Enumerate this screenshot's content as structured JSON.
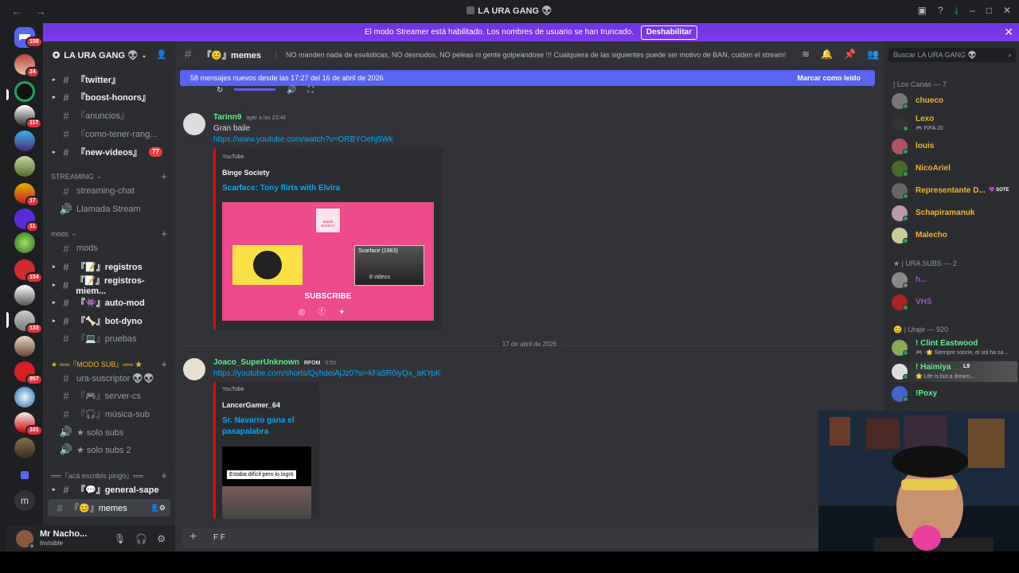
{
  "window": {
    "title": "LA URA GANG 👽"
  },
  "banner": {
    "text": "El modo Streamer está habilitado. Los nombres de usuario se han truncado.",
    "button": "Deshabilitar",
    "close": "✕"
  },
  "guilds": [
    {
      "badge": "158"
    },
    {
      "badge": "24"
    },
    {
      "badge": ""
    },
    {
      "badge": "117"
    },
    {
      "badge": ""
    },
    {
      "badge": ""
    },
    {
      "badge": "17"
    },
    {
      "badge": "11"
    },
    {
      "badge": ""
    },
    {
      "badge": "154"
    },
    {
      "badge": ""
    },
    {
      "badge": "133"
    },
    {
      "badge": ""
    },
    {
      "badge": "957"
    },
    {
      "badge": ""
    },
    {
      "badge": "101"
    },
    {
      "badge": ""
    }
  ],
  "guild_letter": "m",
  "server": {
    "name": "LA URA GANG 👽",
    "channels": [
      {
        "name": "『twitter』"
      },
      {
        "name": "『boost-honors』"
      },
      {
        "name": "『anuncios』"
      },
      {
        "name": "『como-tener-rang..."
      },
      {
        "name": "『new-videos』",
        "mentions": "77"
      }
    ],
    "streaming_category": "STREAMING",
    "streaming_channels": [
      {
        "name": "streaming-chat"
      },
      {
        "name": "Llamada Stream"
      }
    ],
    "mods_category": "mods",
    "mods_channels": [
      {
        "name": "mods"
      },
      {
        "name": "『📝』registros"
      },
      {
        "name": "『📝』registros-miem..."
      },
      {
        "name": "『👾』auto-mod"
      },
      {
        "name": "『🦴』bot-dyno"
      },
      {
        "name": "『💻』pruebas"
      }
    ],
    "sub_category": "★ ══『MODO SUB』══ ★",
    "sub_channels": [
      {
        "name": "ura-suscriptor 👽👽"
      },
      {
        "name": "『🎮』server-cs"
      },
      {
        "name": "『🎧』música-sub"
      },
      {
        "name": "★ solo subs"
      },
      {
        "name": "★ solo subs 2"
      }
    ],
    "pingo_category": "══『acá escribís pingo』══",
    "pingo_channels": [
      {
        "name": "『💬』general-sape"
      },
      {
        "name": "『😊』memes"
      }
    ]
  },
  "user_panel": {
    "name": "Mr Nacho...",
    "status": "Invisible"
  },
  "channel": {
    "name": "『😊』memes",
    "topic": "NO manden nada de esvásticas, NO desnudos, NO peleas ni gente golpeandose !!! Cualquiera de las siguientes puede ser motivo de BAN, cuiden el stream!"
  },
  "new_messages": {
    "text": "58 mensajes nuevos desde las 17:27 del 16 de abril de 2026",
    "action": "Marcar como leído"
  },
  "messages": [
    {
      "author": "Tarinn9",
      "timestamp": "ayer a las 23:46",
      "text": "Gran baile",
      "link": "https://www.youtube.com/watch?v=ORBYOehj5Wk",
      "embed": {
        "provider": "YouTube",
        "author": "Binge Society",
        "title": "Scarface: Tony flirts with Elvira",
        "thumb_brand": "BINGE SOCIETY",
        "thumb_playlist": "Scarface (1983)",
        "thumb_videos": "8 videos",
        "thumb_subscribe": "SUBSCRIBE"
      }
    },
    {
      "author": "Joaco_SuperUnknown",
      "role_tag": "RFOM",
      "timestamp": "0:50",
      "link": "https://youtube.com/shorts/QyhdeiAjJz0?si=kFa5R0iyQx_aKYpK",
      "embed": {
        "provider": "YouTube",
        "author": "LancerGamer_64",
        "title": "Sr. Navarro gana el pasapalabra",
        "caption": "Estaba difícil pero lo logró"
      }
    }
  ],
  "date_divider": "17 de abril de 2026",
  "composer": {
    "text": "F F"
  },
  "member_search": {
    "placeholder": "Buscar LA URA GANG 👽"
  },
  "member_groups": [
    {
      "label": "| Los Canas — 7",
      "members": [
        {
          "name": "chueco",
          "color": "#f0b232"
        },
        {
          "name": "Lexo",
          "sub": "🎮 FIFA 20",
          "color": "#f0b232"
        },
        {
          "name": "louis",
          "color": "#f0b232"
        },
        {
          "name": "NicoAriel",
          "color": "#f0b232"
        },
        {
          "name": "Representante D...",
          "tag": "💜 SOTE",
          "color": "#f0b232"
        },
        {
          "name": "Schapiramanuk",
          "color": "#f0b232"
        },
        {
          "name": "Malecho",
          "color": "#f0b232"
        }
      ]
    },
    {
      "label": "★ | URA SUBS — 2",
      "members": [
        {
          "name": "h...",
          "color": "#9b59b6"
        },
        {
          "name": "VHS",
          "color": "#9b59b6"
        }
      ]
    },
    {
      "label": "😊 | Uraje — 920",
      "members": [
        {
          "name": "! Clint Eastwood",
          "sub": "🎮 -🌟 Siempre sonríe, el sol ha sa...",
          "color": "#57f287"
        },
        {
          "name": "! Haimiya",
          "tag": "L9",
          "sub": "🌟 Life is but a dream...",
          "color": "#57f287"
        },
        {
          "name": "!Poxy",
          "color": "#57f287"
        }
      ]
    }
  ]
}
